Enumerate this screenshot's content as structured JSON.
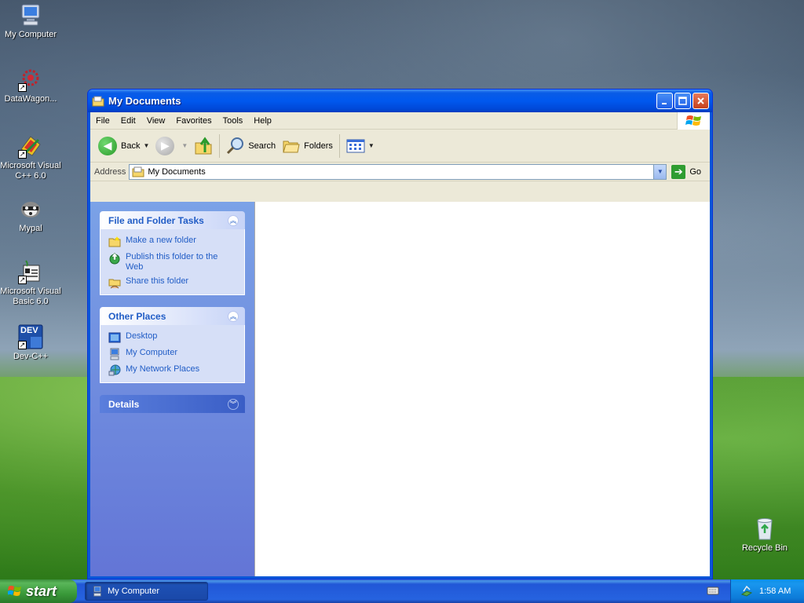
{
  "desktop": {
    "icons": [
      {
        "label": "My Computer",
        "icon": "computer-icon"
      },
      {
        "label": "DataWagon...",
        "icon": "datawagon-icon"
      },
      {
        "label": "Microsoft Visual C++ 6.0",
        "icon": "visual-cpp-icon"
      },
      {
        "label": "Mypal",
        "icon": "mypal-icon"
      },
      {
        "label": "Microsoft Visual Basic 6.0",
        "icon": "visual-basic-icon"
      },
      {
        "label": "Dev-C++",
        "icon": "dev-cpp-icon"
      },
      {
        "label": "Recycle Bin",
        "icon": "recycle-bin-icon"
      }
    ],
    "devcpp_badge": "DEV"
  },
  "window": {
    "title": "My Documents",
    "menu": [
      "File",
      "Edit",
      "View",
      "Favorites",
      "Tools",
      "Help"
    ],
    "toolbar": {
      "back": "Back",
      "search": "Search",
      "folders": "Folders"
    },
    "address": {
      "label": "Address",
      "value": "My Documents",
      "go": "Go"
    },
    "taskpane": {
      "file_tasks": {
        "title": "File and Folder Tasks",
        "items": [
          "Make a new folder",
          "Publish this folder to the Web",
          "Share this folder"
        ]
      },
      "other_places": {
        "title": "Other Places",
        "items": [
          "Desktop",
          "My Computer",
          "My Network Places"
        ]
      },
      "details": {
        "title": "Details"
      }
    }
  },
  "taskbar": {
    "start": "start",
    "active_task": "My Computer",
    "clock": "1:58 AM"
  },
  "colors": {
    "xp_blue": "#0058ee",
    "start_green": "#3a9a3a",
    "link_blue": "#215dc6"
  }
}
